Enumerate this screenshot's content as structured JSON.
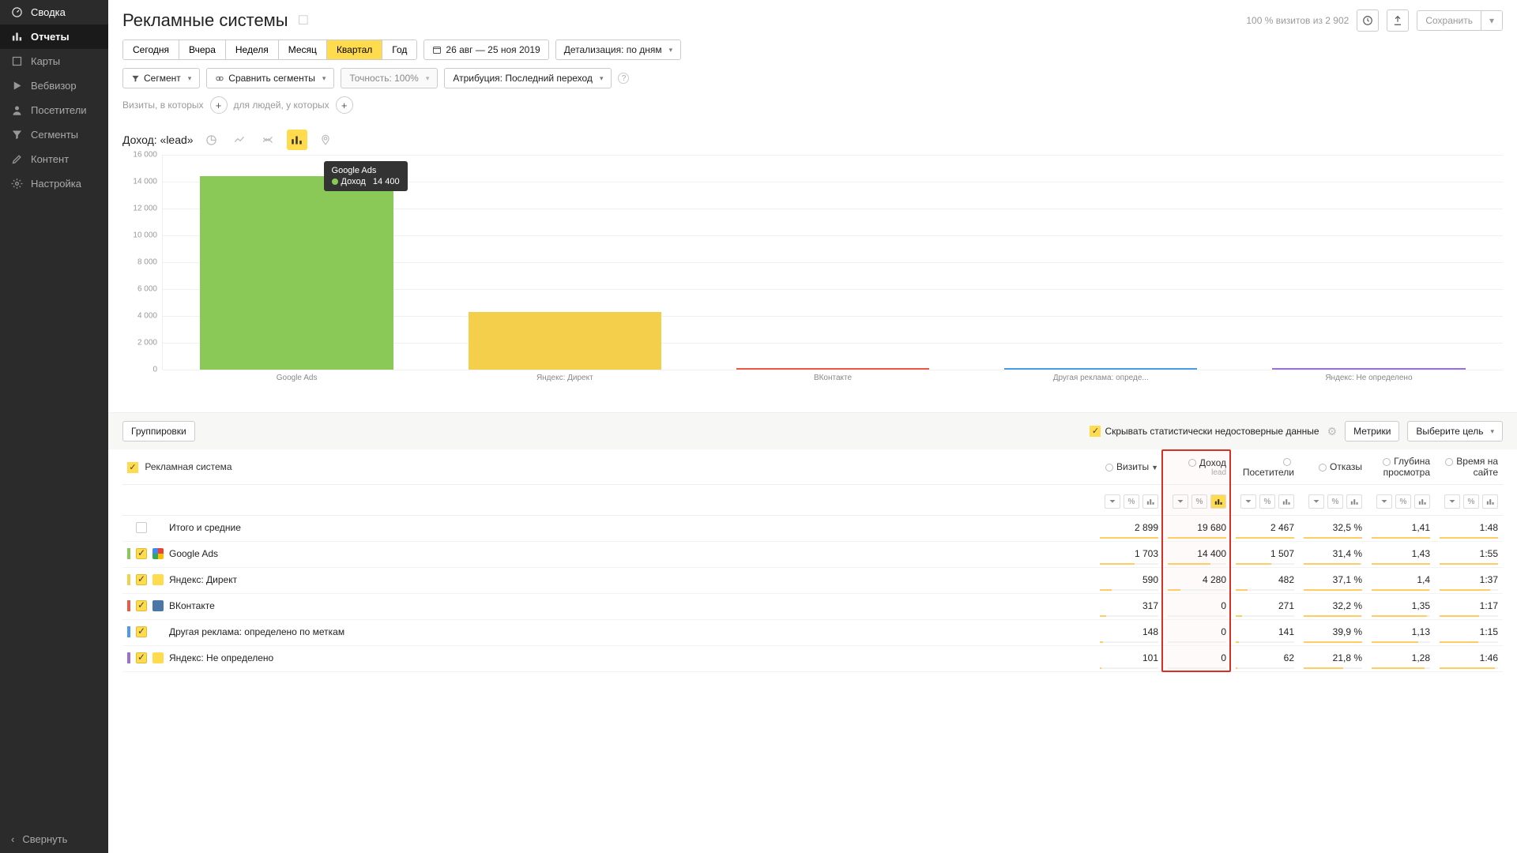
{
  "sidebar": {
    "items": [
      {
        "label": "Сводка",
        "icon": "gauge"
      },
      {
        "label": "Отчеты",
        "icon": "bars",
        "active": true
      },
      {
        "label": "Карты",
        "icon": "map"
      },
      {
        "label": "Вебвизор",
        "icon": "play"
      },
      {
        "label": "Посетители",
        "icon": "user"
      },
      {
        "label": "Сегменты",
        "icon": "funnel"
      },
      {
        "label": "Контент",
        "icon": "pencil"
      },
      {
        "label": "Настройка",
        "icon": "gear"
      }
    ],
    "collapse_label": "Свернуть"
  },
  "header": {
    "title": "Рекламные системы",
    "visits_summary": "100 % визитов из 2 902",
    "save_label": "Сохранить"
  },
  "period_tabs": [
    "Сегодня",
    "Вчера",
    "Неделя",
    "Месяц",
    "Квартал",
    "Год"
  ],
  "period_active": "Квартал",
  "date_range": "26 авг — 25 ноя 2019",
  "detalization_label": "Детализация: по дням",
  "segment_label": "Сегмент",
  "compare_label": "Сравнить сегменты",
  "accuracy_label": "Точность: 100%",
  "attribution_label": "Атрибуция: Последний переход",
  "filters": {
    "visits_in_which": "Визиты, в которых",
    "for_people": "для людей, у которых"
  },
  "metric_title": "Доход: «lead»",
  "chart_data": {
    "type": "bar",
    "ylabel": "",
    "ylim": [
      0,
      16000
    ],
    "yticks": [
      0,
      2000,
      4000,
      6000,
      8000,
      10000,
      12000,
      14000,
      16000
    ],
    "categories": [
      "Google Ads",
      "Яндекс: Директ",
      "ВКонтакте",
      "Другая реклама: опреде...",
      "Яндекс: Не определено"
    ],
    "values": [
      14400,
      4280,
      0,
      0,
      0
    ],
    "colors": [
      "#8ac858",
      "#f4cf4b",
      "#e85b48",
      "#4d9be0",
      "#9b72cf"
    ],
    "tooltip": {
      "category": "Google Ads",
      "metric": "Доход",
      "value": "14 400",
      "color": "#8ac858"
    }
  },
  "table_bar": {
    "grouping_label": "Группировки",
    "hide_insignificant": "Скрывать статистически недостоверные данные",
    "metrics_label": "Метрики",
    "goal_label": "Выберите цель"
  },
  "table": {
    "name_header": "Рекламная система",
    "columns": [
      {
        "label": "Визиты",
        "sort": true
      },
      {
        "label": "Доход",
        "sub": "lead",
        "highlight": true,
        "chart_on": true
      },
      {
        "label": "Посетители"
      },
      {
        "label": "Отказы"
      },
      {
        "label": "Глубина просмотра"
      },
      {
        "label": "Время на сайте"
      }
    ],
    "rows": [
      {
        "mark": "",
        "checked": false,
        "name": "Итого и средние",
        "icon": "",
        "cells": [
          "2 899",
          "19 680",
          "2 467",
          "32,5 %",
          "1,41",
          "1:48"
        ],
        "bars": [
          100,
          100,
          100,
          100,
          100,
          100
        ]
      },
      {
        "mark": "#8ac858",
        "checked": true,
        "name": "Google Ads",
        "icon": "g",
        "cells": [
          "1 703",
          "14 400",
          "1 507",
          "31,4 %",
          "1,43",
          "1:55"
        ],
        "bars": [
          59,
          73,
          61,
          97,
          100,
          100
        ]
      },
      {
        "mark": "#f4cf4b",
        "checked": true,
        "name": "Яндекс: Директ",
        "icon": "y",
        "cells": [
          "590",
          "4 280",
          "482",
          "37,1 %",
          "1,4",
          "1:37"
        ],
        "bars": [
          20,
          22,
          20,
          100,
          98,
          86
        ]
      },
      {
        "mark": "#e85b48",
        "checked": true,
        "name": "ВКонтакте",
        "icon": "vk",
        "cells": [
          "317",
          "0",
          "271",
          "32,2 %",
          "1,35",
          "1:17"
        ],
        "bars": [
          11,
          0,
          11,
          99,
          95,
          68
        ]
      },
      {
        "mark": "#4d9be0",
        "checked": true,
        "name": "Другая реклама: определено по меткам",
        "icon": "",
        "cells": [
          "148",
          "0",
          "141",
          "39,9 %",
          "1,13",
          "1:15"
        ],
        "bars": [
          5,
          0,
          6,
          100,
          80,
          66
        ]
      },
      {
        "mark": "#9b72cf",
        "checked": true,
        "name": "Яндекс: Не определено",
        "icon": "y",
        "cells": [
          "101",
          "0",
          "62",
          "21,8 %",
          "1,28",
          "1:46"
        ],
        "bars": [
          3,
          0,
          3,
          67,
          90,
          94
        ]
      }
    ]
  }
}
